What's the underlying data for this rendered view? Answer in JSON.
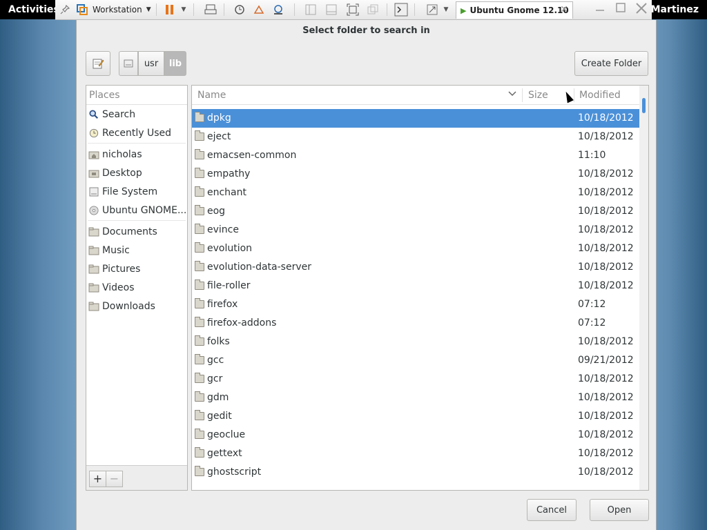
{
  "top_bar": {
    "activities": "Activities",
    "user": "Martinez"
  },
  "vm_toolbar": {
    "workstation_label": "Workstation",
    "tab_label": "Ubuntu Gnome 12.10",
    "tab_close": "✕"
  },
  "dialog": {
    "title": "Select folder to search in",
    "create_folder": "Create Folder",
    "path": [
      "usr",
      "lib"
    ],
    "cancel": "Cancel",
    "open": "Open"
  },
  "places": {
    "header": "Places",
    "items": [
      {
        "label": "Search",
        "icon": "search-icon"
      },
      {
        "label": "Recently Used",
        "icon": "clock-icon"
      },
      {
        "label": "nicholas",
        "icon": "home-folder-icon"
      },
      {
        "label": "Desktop",
        "icon": "desktop-folder-icon"
      },
      {
        "label": "File System",
        "icon": "drive-icon"
      },
      {
        "label": "Ubuntu GNOME...",
        "icon": "disc-icon"
      },
      {
        "label": "Documents",
        "icon": "folder-icon"
      },
      {
        "label": "Music",
        "icon": "folder-icon"
      },
      {
        "label": "Pictures",
        "icon": "folder-icon"
      },
      {
        "label": "Videos",
        "icon": "folder-icon"
      },
      {
        "label": "Downloads",
        "icon": "folder-icon"
      }
    ],
    "add": "+",
    "remove": "−"
  },
  "files": {
    "columns": {
      "name": "Name",
      "size": "Size",
      "modified": "Modified"
    },
    "rows": [
      {
        "name": "dpkg",
        "modified": "10/18/2012",
        "selected": true
      },
      {
        "name": "eject",
        "modified": "10/18/2012"
      },
      {
        "name": "emacsen-common",
        "modified": "11:10"
      },
      {
        "name": "empathy",
        "modified": "10/18/2012"
      },
      {
        "name": "enchant",
        "modified": "10/18/2012"
      },
      {
        "name": "eog",
        "modified": "10/18/2012"
      },
      {
        "name": "evince",
        "modified": "10/18/2012"
      },
      {
        "name": "evolution",
        "modified": "10/18/2012"
      },
      {
        "name": "evolution-data-server",
        "modified": "10/18/2012"
      },
      {
        "name": "file-roller",
        "modified": "10/18/2012"
      },
      {
        "name": "firefox",
        "modified": "07:12"
      },
      {
        "name": "firefox-addons",
        "modified": "07:12"
      },
      {
        "name": "folks",
        "modified": "10/18/2012"
      },
      {
        "name": "gcc",
        "modified": "09/21/2012"
      },
      {
        "name": "gcr",
        "modified": "10/18/2012"
      },
      {
        "name": "gdm",
        "modified": "10/18/2012"
      },
      {
        "name": "gedit",
        "modified": "10/18/2012"
      },
      {
        "name": "geoclue",
        "modified": "10/18/2012"
      },
      {
        "name": "gettext",
        "modified": "10/18/2012"
      },
      {
        "name": "ghostscript",
        "modified": "10/18/2012"
      }
    ]
  }
}
